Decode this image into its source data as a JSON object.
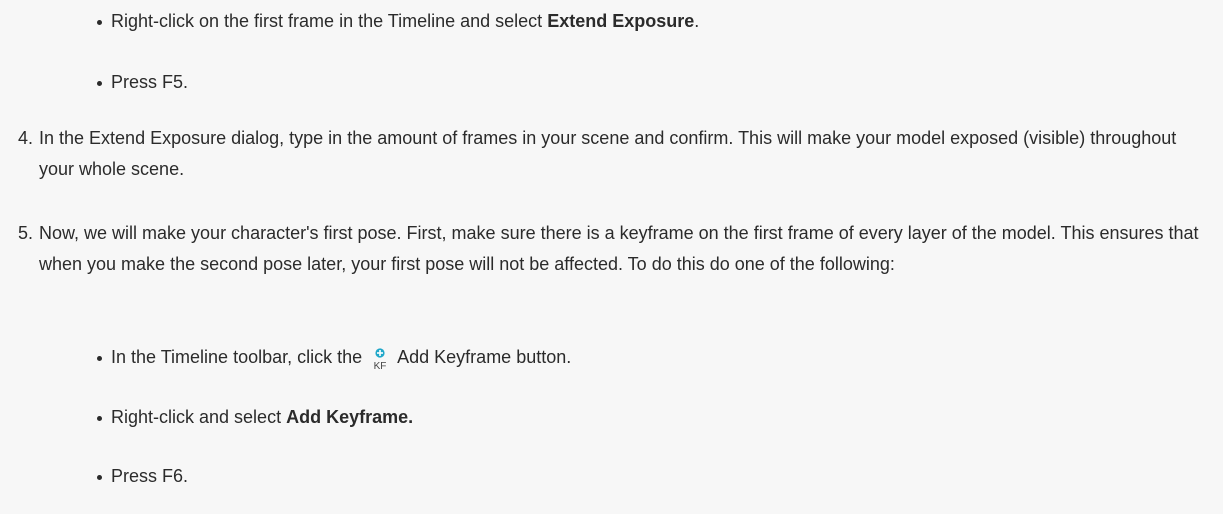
{
  "top_bullets": [
    {
      "text": "Right-click on the first frame in the Timeline and select ",
      "bold": "Extend Exposure",
      "tail": "."
    },
    {
      "text": "Press F5."
    }
  ],
  "steps": [
    {
      "number": "4.",
      "text": "In the Extend Exposure dialog, type in the amount of frames in your scene and confirm. This will make your model exposed (visible) throughout your whole scene."
    },
    {
      "number": "5.",
      "text": "Now, we will make your character's first pose. First, make sure there is a keyframe on the first frame of every layer of the model. This ensures that when you make the second pose later, your first pose will not be affected. To do this do one of the following:"
    }
  ],
  "step5_bullets": [
    {
      "before_icon": "In the Timeline toolbar, click the ",
      "icon": "add-keyframe-icon",
      "icon_label": "KF",
      "after_icon": "Add Keyframe button."
    },
    {
      "text": "Right-click and select ",
      "bold": "Add Keyframe."
    },
    {
      "text": "Press F6."
    }
  ],
  "colors": {
    "background": "#f7f7f7",
    "text": "#2b2b2b",
    "icon_plus": "#1fa7c9"
  }
}
